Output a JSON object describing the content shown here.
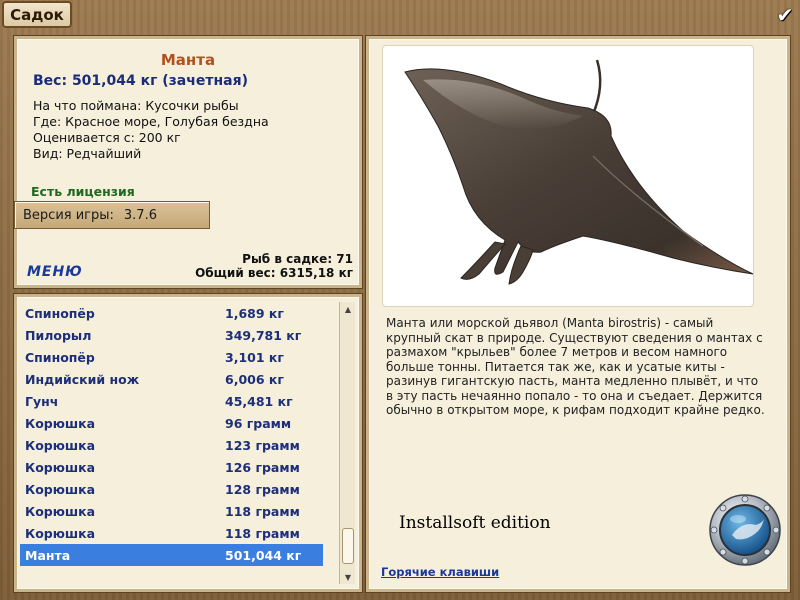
{
  "window": {
    "title": "Садок",
    "confirm_icon": "checkmark-icon"
  },
  "fish": {
    "name": "Манта",
    "weight": "Вес: 501,044 кг (зачетная)",
    "caught_on": "На что поймана: Кусочки рыбы",
    "location": "Где: Красное море, Голубая бездна",
    "value": "Оценивается с: 200 кг",
    "rarity": "Вид: Редчайший",
    "license": "Есть лицензия"
  },
  "version": {
    "label": "Версия игры:",
    "value": "3.7.6"
  },
  "stats": {
    "count": "Рыб в садке: 71",
    "total_weight": "Общий вес: 6315,18 кг"
  },
  "menu_label": "МЕНЮ",
  "catch_list": [
    {
      "name": "Спинопёр",
      "weight": "1,689 кг"
    },
    {
      "name": "Пилорыл",
      "weight": "349,781 кг"
    },
    {
      "name": "Спинопёр",
      "weight": "3,101 кг"
    },
    {
      "name": "Индийский нож",
      "weight": "6,006 кг"
    },
    {
      "name": "Гунч",
      "weight": "45,481 кг"
    },
    {
      "name": "Корюшка",
      "weight": "96 грамм"
    },
    {
      "name": "Корюшка",
      "weight": "123 грамм"
    },
    {
      "name": "Корюшка",
      "weight": "126 грамм"
    },
    {
      "name": "Корюшка",
      "weight": "128 грамм"
    },
    {
      "name": "Корюшка",
      "weight": "118 грамм"
    },
    {
      "name": "Корюшка",
      "weight": "118 грамм"
    },
    {
      "name": "Манта",
      "weight": "501,044 кг",
      "selected": true
    }
  ],
  "description": "Манта или морской дьявол (Manta birostris) - самый крупный скат в природе. Существуют сведения о мантах с размахом \"крыльев\" более 7 метров и весом намного больше тонны. Питается так же, как и усатые киты - разинув гигантскую пасть, манта медленно плывёт, и что в эту пасть нечаянно попало - то она и съедает. Держится обычно в открытом море, к рифам подходит крайне редко.",
  "edition": "Installsoft edition",
  "hotkeys_label": "Горячие клавиши",
  "colors": {
    "fish_name": "#b4501a",
    "list_text": "#1d2f78",
    "selected_row": "#3a7fe0",
    "license": "#1f6a1f"
  }
}
